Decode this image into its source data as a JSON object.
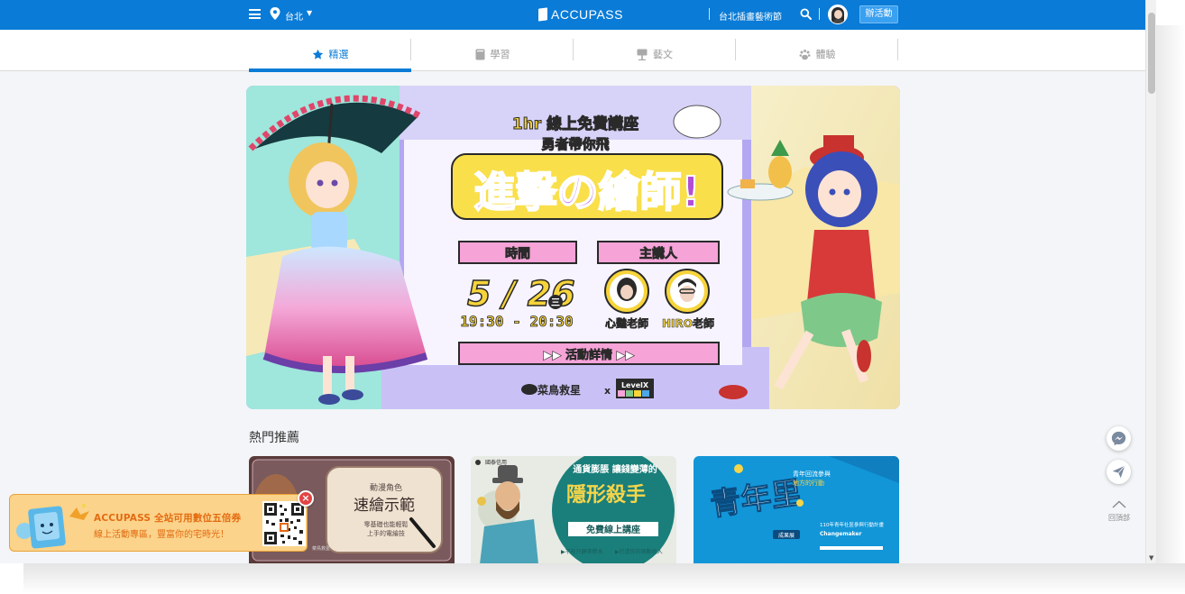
{
  "nav": {
    "city": "台北",
    "logo_text": "ACCUPASS",
    "organizer_link": "台北插畫藝術節",
    "create_button": "辦活動"
  },
  "tabs": [
    {
      "label": "精選",
      "icon": "star-icon",
      "active": true
    },
    {
      "label": "學習",
      "icon": "book-icon",
      "active": false
    },
    {
      "label": "藝文",
      "icon": "easel-icon",
      "active": false
    },
    {
      "label": "體驗",
      "icon": "paw-icon",
      "active": false
    }
  ],
  "banner": {
    "top_line1": "1hr 線上免費講座",
    "top_line2": "勇者帶你飛",
    "title": "進擊の繪師!",
    "time_label": "時間",
    "speaker_label": "主講人",
    "date": "5 / 26",
    "weekday": "三",
    "time_range": "19:30 - 20:30",
    "speaker1": "心豔老師",
    "speaker2": "HIRO老師",
    "detail_button": "▶▶ 活動詳情 ▶▶",
    "org_left": "菜鳥救星",
    "org_x": "x",
    "org_right": "LevelX"
  },
  "section": {
    "title": "熱門推薦"
  },
  "cards": [
    {
      "title": "動漫角色",
      "subtitle": "速繪示範",
      "caption_line1": "零基礎也能輕鬆",
      "caption_line2": "上手的電繪技",
      "corner": "菜鳥救星"
    },
    {
      "badge": "國泰信用",
      "headline": "通貨膨脹 讓錢變薄的",
      "big": "隱形殺手",
      "ribbon": "免費線上講座",
      "tag1": "▶不能只顧來薪水",
      "tag2": "▶打造你的現動收入"
    },
    {
      "big": "青年里",
      "note1": "青年回流參與",
      "note2": "地方的行動",
      "small1": "110年青年社區參與行動計畫",
      "small2": "Changemaker",
      "tag": "成果展"
    }
  ],
  "promo": {
    "line1": "ACCUPASS 全站可用數位五倍券",
    "line2": "線上活動專區，豐富你的宅時光！",
    "close": "×"
  },
  "floating": {
    "to_top_label": "回頂部"
  },
  "colors": {
    "brand": "#0a7bd6",
    "promo_text": "#e36b12",
    "banner_purple": "#b3a7f2",
    "banner_pink": "#f6a3d8"
  }
}
